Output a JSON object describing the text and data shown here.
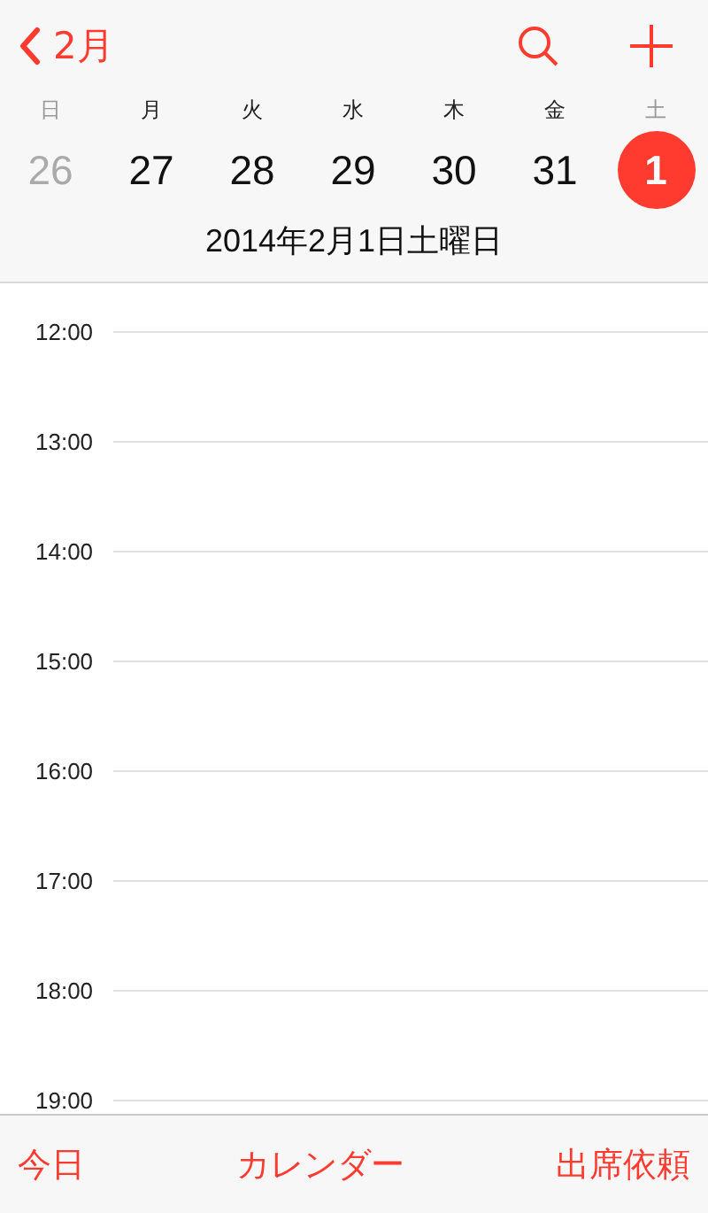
{
  "nav": {
    "back_label": "2月"
  },
  "week": [
    {
      "weekday": "日",
      "date": "26",
      "dimmed": true,
      "selected": false
    },
    {
      "weekday": "月",
      "date": "27",
      "dimmed": false,
      "selected": false
    },
    {
      "weekday": "火",
      "date": "28",
      "dimmed": false,
      "selected": false
    },
    {
      "weekday": "水",
      "date": "29",
      "dimmed": false,
      "selected": false
    },
    {
      "weekday": "木",
      "date": "30",
      "dimmed": false,
      "selected": false
    },
    {
      "weekday": "金",
      "date": "31",
      "dimmed": false,
      "selected": false
    },
    {
      "weekday": "土",
      "date": "1",
      "dimmed": true,
      "selected": true
    }
  ],
  "date_title": "2014年2月1日土曜日",
  "hours": [
    "12:00",
    "13:00",
    "14:00",
    "15:00",
    "16:00",
    "17:00",
    "18:00",
    "19:00"
  ],
  "toolbar": [
    "今日",
    "カレンダー",
    "出席依頼"
  ]
}
